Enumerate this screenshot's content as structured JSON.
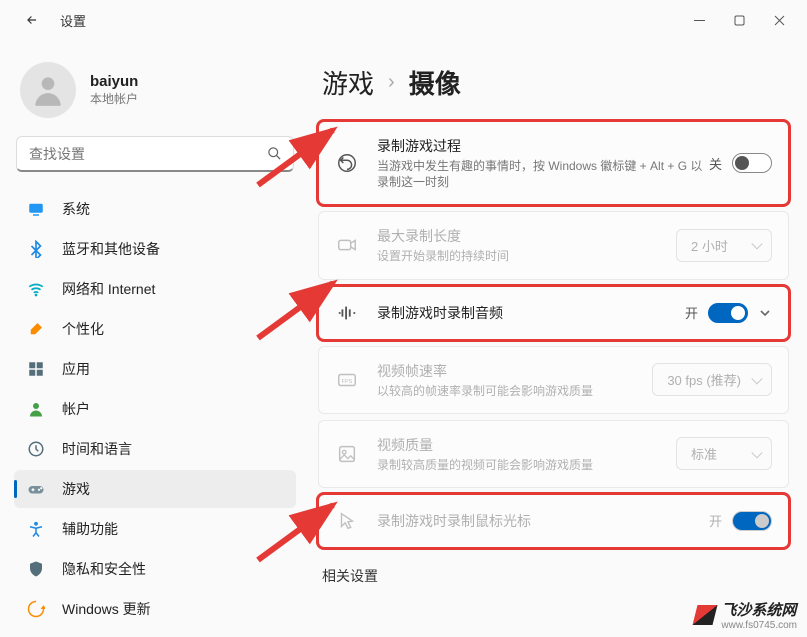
{
  "titlebar": {
    "title": "设置"
  },
  "profile": {
    "name": "baiyun",
    "subtitle": "本地帐户"
  },
  "search": {
    "placeholder": "查找设置"
  },
  "nav": {
    "items": [
      {
        "label": "系统",
        "icon": "system",
        "color": "#2196f3"
      },
      {
        "label": "蓝牙和其他设备",
        "icon": "bluetooth",
        "color": "#1e88e5"
      },
      {
        "label": "网络和 Internet",
        "icon": "wifi",
        "color": "#00acc1"
      },
      {
        "label": "个性化",
        "icon": "brush",
        "color": "#fb8c00"
      },
      {
        "label": "应用",
        "icon": "apps",
        "color": "#546e7a"
      },
      {
        "label": "帐户",
        "icon": "person",
        "color": "#43a047"
      },
      {
        "label": "时间和语言",
        "icon": "clock",
        "color": "#546e7a"
      },
      {
        "label": "游戏",
        "icon": "gamepad",
        "color": "#78909c",
        "active": true
      },
      {
        "label": "辅助功能",
        "icon": "accessibility",
        "color": "#1e88e5"
      },
      {
        "label": "隐私和安全性",
        "icon": "shield",
        "color": "#546e7a"
      },
      {
        "label": "Windows 更新",
        "icon": "update",
        "color": "#fb8c00"
      }
    ]
  },
  "breadcrumb": {
    "parent": "游戏",
    "current": "摄像"
  },
  "settings": [
    {
      "key": "record-clip",
      "title": "录制游戏过程",
      "desc": "当游戏中发生有趣的事情时，按 Windows 徽标键 + Alt + G 以录制这一时刻",
      "icon": "rewind",
      "controlType": "toggle",
      "state": "off",
      "stateLabel": "关",
      "highlight": true
    },
    {
      "key": "max-length",
      "title": "最大录制长度",
      "desc": "设置开始录制的持续时间",
      "icon": "camcorder",
      "controlType": "select",
      "value": "2 小时",
      "muted": true
    },
    {
      "key": "record-audio",
      "title": "录制游戏时录制音频",
      "desc": "",
      "icon": "waveform",
      "controlType": "toggle-expand",
      "state": "on",
      "stateLabel": "开",
      "highlight": true
    },
    {
      "key": "fps",
      "title": "视频帧速率",
      "desc": "以较高的帧速率录制可能会影响游戏质量",
      "icon": "fps",
      "controlType": "select",
      "value": "30 fps (推荐)",
      "muted": true
    },
    {
      "key": "quality",
      "title": "视频质量",
      "desc": "录制较高质量的视频可能会影响游戏质量",
      "icon": "quality",
      "controlType": "select",
      "value": "标准",
      "muted": true
    },
    {
      "key": "cursor",
      "title": "录制游戏时录制鼠标光标",
      "desc": "",
      "icon": "cursor",
      "controlType": "toggle",
      "state": "on-disabled",
      "stateLabel": "开",
      "muted": true,
      "highlight": true
    }
  ],
  "sectionTitle": "相关设置",
  "watermark": {
    "cn": "飞沙系统网",
    "en": "www.fs0745.com"
  }
}
